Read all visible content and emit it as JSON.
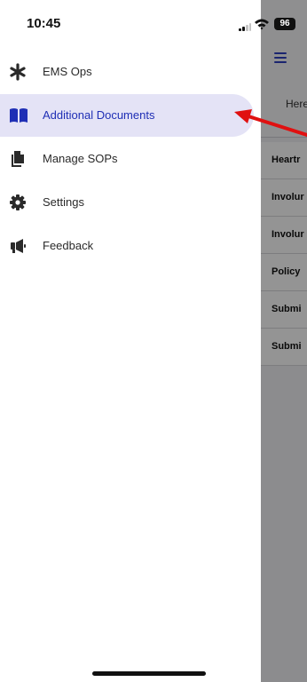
{
  "status_bar": {
    "time": "10:45",
    "battery": "96"
  },
  "background_page": {
    "intro_text": "Here",
    "rows": [
      "Heartr",
      "Involur",
      "Involur",
      "Policy",
      "Submi",
      "Submi"
    ]
  },
  "drawer": {
    "items": [
      {
        "label": "EMS Ops",
        "icon": "asterisk-icon",
        "active": false
      },
      {
        "label": "Additional Documents",
        "icon": "book-icon",
        "active": true
      },
      {
        "label": "Manage SOPs",
        "icon": "documents-icon",
        "active": false
      },
      {
        "label": "Settings",
        "icon": "gear-icon",
        "active": false
      },
      {
        "label": "Feedback",
        "icon": "megaphone-icon",
        "active": false
      }
    ]
  },
  "colors": {
    "accent": "#1f2fb5",
    "active_bg": "#e4e3f6",
    "annotation_arrow": "#e01010"
  }
}
